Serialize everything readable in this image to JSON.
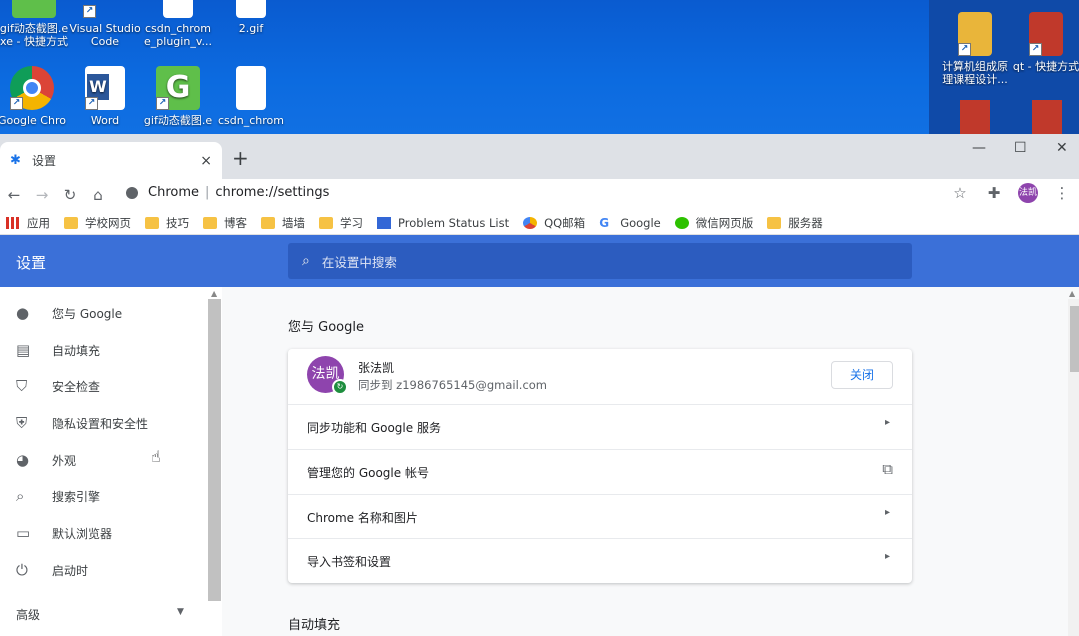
{
  "desktop": {
    "icons": [
      {
        "label": "gif动态截图.e xe - 快捷方式"
      },
      {
        "label": "Visual Studio Code"
      },
      {
        "label": "csdn_chrom e_plugin_v..."
      },
      {
        "label": "2.gif"
      },
      {
        "label": "Google Chro"
      },
      {
        "label": "Word"
      },
      {
        "label": "gif动态截图.e"
      },
      {
        "label": "csdn_chrom"
      },
      {
        "label": "计算机组成原 理课程设计..."
      },
      {
        "label": "qt - 快捷方式"
      }
    ]
  },
  "browser": {
    "tab": {
      "title": "设置",
      "close": "×",
      "favicon": "gear-icon"
    },
    "new_tab": "+",
    "window_controls": {
      "minimize": "—",
      "maximize": "☐",
      "close": "✕"
    },
    "address": {
      "site": "Chrome",
      "separator": "|",
      "url": "chrome://settings"
    },
    "profile_initials": "法凯",
    "bookmarks": [
      {
        "label": "应用",
        "icon": "apps-grid-icon"
      },
      {
        "label": "学校网页",
        "icon": "folder-icon"
      },
      {
        "label": "技巧",
        "icon": "folder-icon"
      },
      {
        "label": "博客",
        "icon": "folder-icon"
      },
      {
        "label": "墙墙",
        "icon": "folder-icon"
      },
      {
        "label": "学习",
        "icon": "folder-icon"
      },
      {
        "label": "Problem Status List",
        "icon": "page-icon"
      },
      {
        "label": "QQ邮箱",
        "icon": "qqmail-icon"
      },
      {
        "label": "Google",
        "icon": "google-icon"
      },
      {
        "label": "微信网页版",
        "icon": "wechat-icon"
      },
      {
        "label": "服务器",
        "icon": "folder-icon"
      }
    ]
  },
  "settings": {
    "title": "设置",
    "search_placeholder": "在设置中搜索",
    "sidebar": [
      {
        "label": "您与 Google",
        "icon": "person-icon"
      },
      {
        "label": "自动填充",
        "icon": "clipboard-icon"
      },
      {
        "label": "安全检查",
        "icon": "shield-check-icon"
      },
      {
        "label": "隐私设置和安全性",
        "icon": "shield-icon"
      },
      {
        "label": "外观",
        "icon": "palette-icon"
      },
      {
        "label": "搜索引擎",
        "icon": "search-icon"
      },
      {
        "label": "默认浏览器",
        "icon": "browser-window-icon"
      },
      {
        "label": "启动时",
        "icon": "power-icon"
      }
    ],
    "advanced": "高级",
    "section_you_google": "您与 Google",
    "profile": {
      "avatar_text": "法凯",
      "name": "张法凯",
      "email": "同步到 z1986765145@gmail.com",
      "close_button": "关闭"
    },
    "rows": [
      {
        "label": "同步功能和 Google 服务",
        "end": "▸"
      },
      {
        "label": "管理您的 Google 帐号",
        "end": "⧉"
      },
      {
        "label": "Chrome 名称和图片",
        "end": "▸"
      },
      {
        "label": "导入书签和设置",
        "end": "▸"
      }
    ],
    "section_autofill": "自动填充"
  },
  "colors": {
    "header_blue": "#3b70d8",
    "accent": "#1a73e8",
    "avatar": "#8e44ad"
  }
}
